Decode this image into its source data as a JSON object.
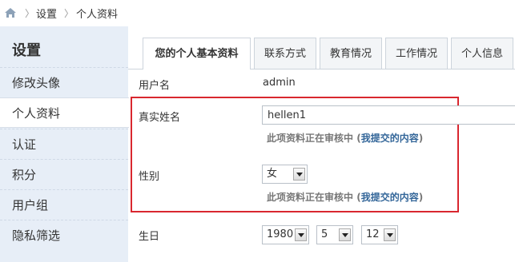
{
  "breadcrumb": {
    "items": [
      "设置",
      "个人资料"
    ]
  },
  "sidebar": {
    "title": "设置",
    "items": [
      {
        "label": "修改头像",
        "active": false
      },
      {
        "label": "个人资料",
        "active": true
      },
      {
        "label": "认证",
        "active": false
      },
      {
        "label": "积分",
        "active": false
      },
      {
        "label": "用户组",
        "active": false
      },
      {
        "label": "隐私筛选",
        "active": false
      }
    ]
  },
  "tabs": [
    {
      "label": "您的个人基本资料",
      "active": true
    },
    {
      "label": "联系方式",
      "active": false
    },
    {
      "label": "教育情况",
      "active": false
    },
    {
      "label": "工作情况",
      "active": false
    },
    {
      "label": "个人信息",
      "active": false
    }
  ],
  "form": {
    "username_label": "用户名",
    "username_value": "admin",
    "realname_label": "真实姓名",
    "realname_value": "hellen1",
    "realname_note": "此项资料正在审核中",
    "realname_note_link": "我提交的内容",
    "gender_label": "性别",
    "gender_value": "女",
    "gender_note": "此项资料正在审核中",
    "gender_note_link": "我提交的内容",
    "birthday_label": "生日",
    "birthday_year": "1980",
    "birthday_month": "5",
    "birthday_day": "12"
  },
  "colors": {
    "highlight": "#d9272f",
    "sidebar_bg": "#e7eef7",
    "link": "#336699"
  }
}
